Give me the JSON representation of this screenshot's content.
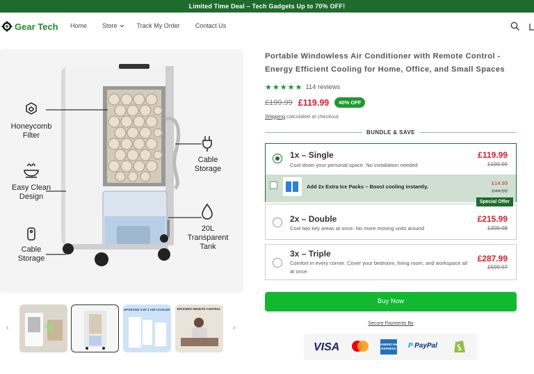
{
  "banner": "Limited Time Deal – Tech Gadgets Up to 70% OFF!",
  "brand": {
    "name": "Gear Tech",
    "color": "#1c8c2a"
  },
  "nav": {
    "home": "Home",
    "store": "Store",
    "track": "Track My Order",
    "contact": "Contact Us"
  },
  "gallery": {
    "features": {
      "honeycomb": "Honeycomb\nFilter",
      "clean": "Easy Clean\nDesign",
      "cable_left": "Cable\nStorage",
      "cable_right": "Cable\nStorage",
      "tank": "20L\nTransparent\nTank"
    },
    "thumb3_caption": "UPGRADE 3-IN-1 AIR COOLER",
    "thumb4_caption": "EFFICIENT REMOTE CONTROL"
  },
  "product": {
    "title": "Portable Windowless Air Conditioner with Remote Control - Energy Efficient Cooling for Home, Office, and Small Spaces",
    "stars": "★★★★★",
    "reviews": "114 reviews",
    "old_price": "£199.99",
    "price": "£119.99",
    "badge": "40% OFF",
    "shipping_link": "Shipping",
    "shipping_text": " calculated at checkout."
  },
  "bundle": {
    "heading": "BUNDLE & SAVE",
    "options": [
      {
        "name": "1x – Single",
        "desc": "Cool down your personal space. No installation needed",
        "price": "£119.99",
        "old": "£199.99"
      },
      {
        "name": "2x – Double",
        "desc": "Cool two key areas at once. No more moving units around",
        "price": "£215.99",
        "old": "£399.98",
        "tag": "Special Offer"
      },
      {
        "name": "3x – Triple",
        "desc": "Comfort in every corner. Cover your bedroom, living room, and workspace all at once",
        "price": "£287.99",
        "old": "£599.97"
      }
    ],
    "addon": {
      "label": "Add 2x Extra Ice Packs – Boost cooling instantly.",
      "price": "£14.99",
      "old": "£44.99"
    }
  },
  "buy_label": "Buy Now",
  "secure_label": "Secure Payments By",
  "payments": {
    "visa": "VISA",
    "paypal": "PayPal",
    "amex": "AMERICAN EXPRESS"
  }
}
